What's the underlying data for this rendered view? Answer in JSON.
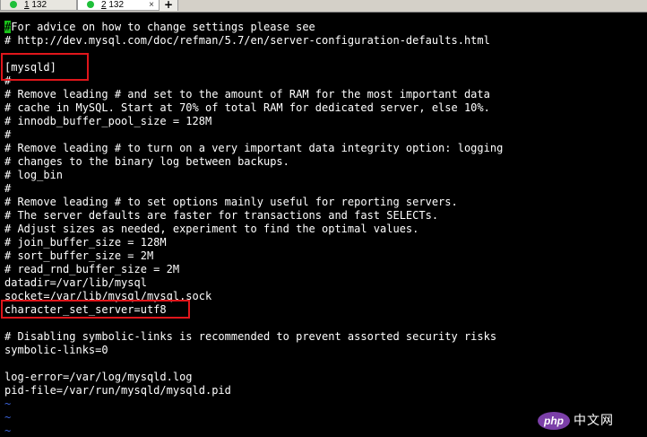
{
  "tabs": [
    {
      "prefix": "1",
      "rest": " 132"
    },
    {
      "prefix": "2",
      "rest": " 132",
      "close": "×"
    }
  ],
  "new_tab_label": "+",
  "cursor_char": "#",
  "terminal": {
    "lines": [
      " For advice on how to change settings please see",
      "# http://dev.mysql.com/doc/refman/5.7/en/server-configuration-defaults.html",
      "",
      "[mysqld]",
      "#",
      "# Remove leading # and set to the amount of RAM for the most important data",
      "# cache in MySQL. Start at 70% of total RAM for dedicated server, else 10%.",
      "# innodb_buffer_pool_size = 128M",
      "#",
      "# Remove leading # to turn on a very important data integrity option: logging",
      "# changes to the binary log between backups.",
      "# log_bin",
      "#",
      "# Remove leading # to set options mainly useful for reporting servers.",
      "# The server defaults are faster for transactions and fast SELECTs.",
      "# Adjust sizes as needed, experiment to find the optimal values.",
      "# join_buffer_size = 128M",
      "# sort_buffer_size = 2M",
      "# read_rnd_buffer_size = 2M",
      "datadir=/var/lib/mysql",
      "socket=/var/lib/mysql/mysql.sock",
      "character_set_server=utf8",
      "",
      "# Disabling symbolic-links is recommended to prevent assorted security risks",
      "symbolic-links=0",
      "",
      "log-error=/var/log/mysqld.log",
      "pid-file=/var/run/mysqld/mysqld.pid",
      "~",
      "~",
      "~"
    ]
  },
  "watermark": {
    "logo": "php",
    "text": "中文网"
  },
  "colors": {
    "background": "#000000",
    "text": "#ffffff",
    "tilde": "#3a62d9",
    "cursor": "#19c219",
    "highlight_box": "#e0161b",
    "tab_dot": "#1fbf3a"
  }
}
